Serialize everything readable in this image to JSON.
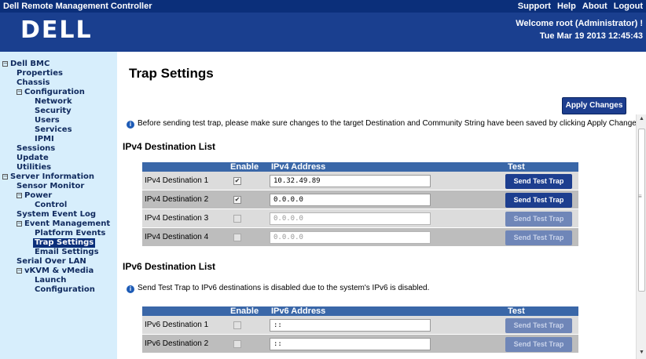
{
  "topbar": {
    "title": "Dell Remote Management Controller",
    "links": [
      "Support",
      "Help",
      "About",
      "Logout"
    ]
  },
  "header": {
    "logo": "DELL",
    "welcome": "Welcome root (Administrator) !",
    "datetime": "Tue Mar 19 2013 12:45:43"
  },
  "sidebar": {
    "items": [
      "Dell BMC",
      "Properties",
      "Chassis",
      "Configuration",
      "Network",
      "Security",
      "Users",
      "Services",
      "IPMI",
      "Sessions",
      "Update",
      "Utilities",
      "Server Information",
      "Sensor Monitor",
      "Power",
      "Control",
      "System Event Log",
      "Event Management",
      "Platform Events",
      "Trap Settings",
      "Email Settings",
      "Serial Over LAN",
      "vKVM & vMedia",
      "Launch",
      "Configuration"
    ],
    "selected": "Trap Settings"
  },
  "page": {
    "title": "Trap Settings",
    "apply_label": "Apply Changes",
    "note": "Before sending test trap, please make sure changes to the target Destination and Community String have been saved by clicking Apply Changes.",
    "ipv4": {
      "heading": "IPv4 Destination List",
      "columns": {
        "enable": "Enable",
        "address": "IPv4 Address",
        "test": "Test"
      },
      "rows": [
        {
          "label": "IPv4 Destination 1",
          "enabled": true,
          "address": "10.32.49.89",
          "button": "Send Test Trap"
        },
        {
          "label": "IPv4 Destination 2",
          "enabled": true,
          "address": "0.0.0.0",
          "button": "Send Test Trap"
        },
        {
          "label": "IPv4 Destination 3",
          "enabled": false,
          "address": "0.0.0.0",
          "button": "Send Test Trap"
        },
        {
          "label": "IPv4 Destination 4",
          "enabled": false,
          "address": "0.0.0.0",
          "button": "Send Test Trap"
        }
      ]
    },
    "ipv6": {
      "heading": "IPv6 Destination List",
      "note": "Send Test Trap to IPv6 destinations is disabled due to the system's IPv6 is disabled.",
      "columns": {
        "enable": "Enable",
        "address": "IPv6 Address",
        "test": "Test"
      },
      "rows": [
        {
          "label": "IPv6 Destination 1",
          "enabled": false,
          "address": "::",
          "button": "Send Test Trap"
        },
        {
          "label": "IPv6 Destination 2",
          "enabled": false,
          "address": "::",
          "button": "Send Test Trap"
        }
      ]
    }
  },
  "colors": {
    "topbar": "#0b2f7a",
    "header": "#1a3f8f",
    "sidebar": "#d7eefc",
    "table_header": "#3a67a8",
    "button": "#1d3e8f"
  }
}
